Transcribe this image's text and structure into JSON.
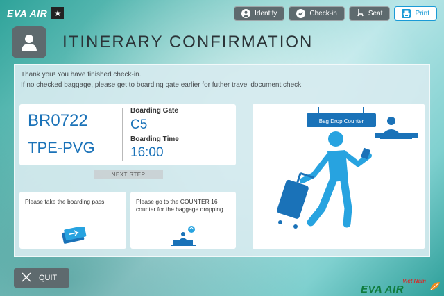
{
  "header": {
    "logo_text": "EVA AIR",
    "logo_star": "★",
    "nav": [
      {
        "label": "Identify",
        "icon": "person-icon"
      },
      {
        "label": "Check-in",
        "icon": "check-icon"
      },
      {
        "label": "Seat",
        "icon": "seat-icon"
      },
      {
        "label": "Print",
        "icon": "printer-icon"
      }
    ]
  },
  "page": {
    "title": "ITINERARY CONFIRMATION",
    "message_line1": "Thank you! You have finished check-in.",
    "message_line2": "If no checked baggage, please get to boarding gate earlier for futher travel document check."
  },
  "flight": {
    "number": "BR0722",
    "route": "TPE-PVG",
    "gate_label": "Boarding Gate",
    "gate": "C5",
    "time_label": "Boarding Time",
    "time": "16:00"
  },
  "next_step_label": "NEXT STEP",
  "cards": {
    "pass_text": "Please take the boarding pass.",
    "counter_text": "Please go to the COUNTER 16 counter for the baggage dropping"
  },
  "illustration": {
    "sign_label": "Bag Drop Counter"
  },
  "footer": {
    "quit_label": "QUIT",
    "brand_top": "Việt Nam",
    "brand_main": "EVA AIR"
  },
  "colors": {
    "accent_blue": "#1a72b8",
    "figure_blue": "#27a3e0",
    "nav_gray": "#5e6a6e"
  }
}
